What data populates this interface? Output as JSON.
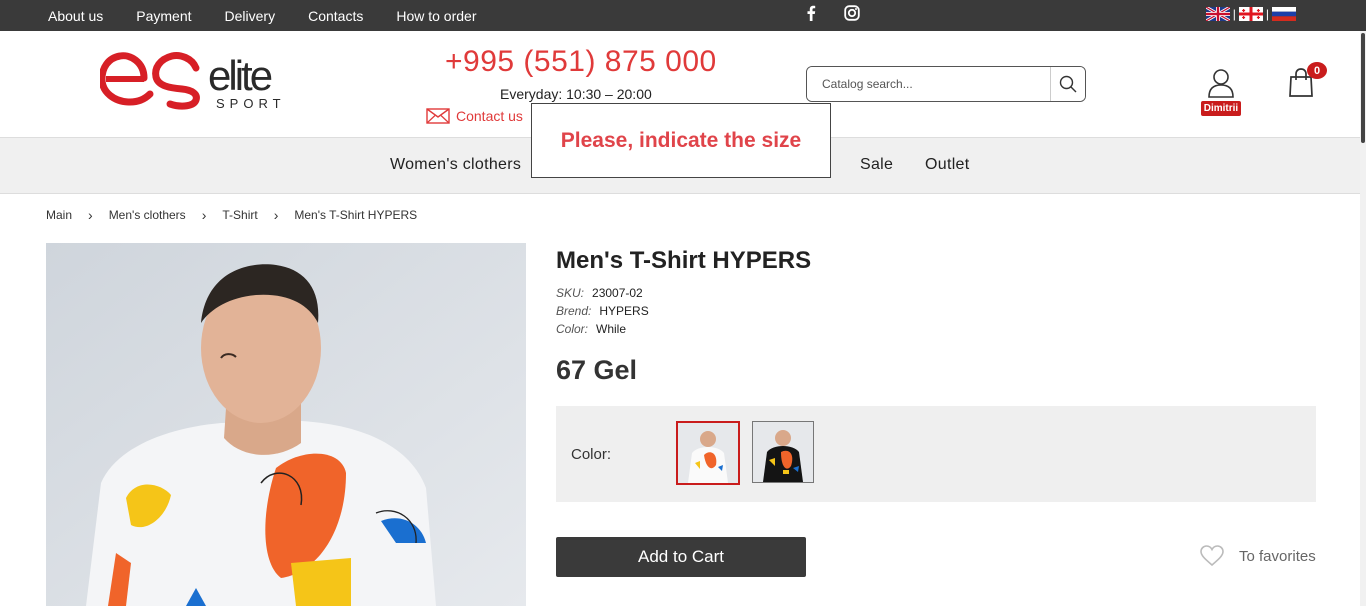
{
  "topbar": {
    "links": [
      "About us",
      "Payment",
      "Delivery",
      "Contacts",
      "How to order"
    ],
    "languages": [
      "en",
      "ka",
      "ru"
    ]
  },
  "header": {
    "logo": {
      "brand": "elite",
      "sub": "SPORT"
    },
    "phone": "+995 (551) 875 000",
    "hours": "Everyday: 10:30 – 20:00",
    "contact_label": "Contact us",
    "search_placeholder": "Catalog search...",
    "user_name": "Dimitrii",
    "cart_count": "0"
  },
  "mainnav": {
    "women": "Women's clothers",
    "sale": "Sale",
    "outlet": "Outlet"
  },
  "popup": {
    "message": "Please, indicate the size"
  },
  "breadcrumb": [
    "Main",
    "Men's clothers",
    "T-Shirt",
    "Men's T-Shirt HYPERS"
  ],
  "product": {
    "title": "Men's T-Shirt HYPERS",
    "sku_label": "SKU:",
    "sku": "23007-02",
    "brand_label": "Brend:",
    "brand": "HYPERS",
    "color_label": "Color:",
    "color": "While",
    "price": "67 Gel",
    "color_selector_label": "Color:",
    "add_to_cart": "Add to Cart",
    "favorites": "To favorites"
  },
  "colors": {
    "accent": "#e03a3a",
    "badge": "#c91c1c",
    "topbar_bg": "#3a3a3a"
  }
}
